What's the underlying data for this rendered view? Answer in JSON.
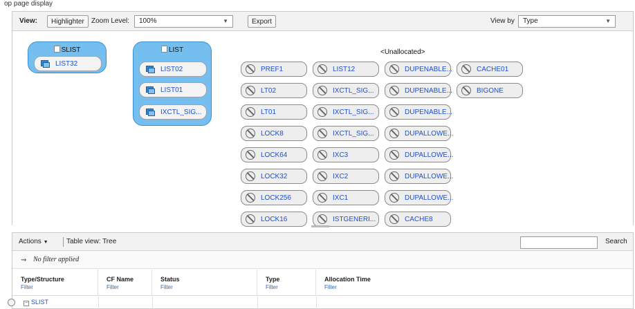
{
  "caption": "op page display",
  "toolbar": {
    "view_label": "View:",
    "highlighter_label": "Highlighter",
    "zoom_label": "Zoom Level:",
    "zoom_value": "100%",
    "export_label": "Export",
    "viewby_label": "View by",
    "viewby_value": "Type"
  },
  "groups": {
    "slist": {
      "title": "SLIST",
      "items": [
        "LIST32"
      ]
    },
    "list": {
      "title": "LIST",
      "items": [
        "LIST02",
        "LIST01",
        "IXCTL_SIG..."
      ]
    }
  },
  "unallocated": {
    "title": "<Unallocated>",
    "col1": [
      "PREF1",
      "LT02",
      "LT01",
      "LOCK8",
      "LOCK64",
      "LOCK32",
      "LOCK256",
      "LOCK16"
    ],
    "col2": [
      "LIST12",
      "IXCTL_SIG...",
      "IXCTL_SIG...",
      "IXCTL_SIG...",
      "IXC3",
      "IXC2",
      "IXC1",
      "ISTGENERI..."
    ],
    "col3": [
      "DUPENABLE...",
      "DUPENABLE...",
      "DUPENABLE...",
      "DUPALLOWE...",
      "DUPALLOWE...",
      "DUPALLOWE...",
      "DUPALLOWE...",
      "CACHE8"
    ],
    "col4": [
      "CACHE01",
      "BIGONE"
    ]
  },
  "table": {
    "actions_label": "Actions",
    "view_label": "Table view: Tree",
    "search_label": "Search",
    "filter_status": "No filter applied",
    "columns": [
      {
        "name": "Type/Structure",
        "filter": "Filter"
      },
      {
        "name": "CF Name",
        "filter": "Filter"
      },
      {
        "name": "Status",
        "filter": "Filter"
      },
      {
        "name": "Type",
        "filter": "Filter"
      },
      {
        "name": "Allocation Time",
        "filter": "Filter"
      }
    ],
    "rows": [
      {
        "label": "SLIST"
      }
    ]
  }
}
